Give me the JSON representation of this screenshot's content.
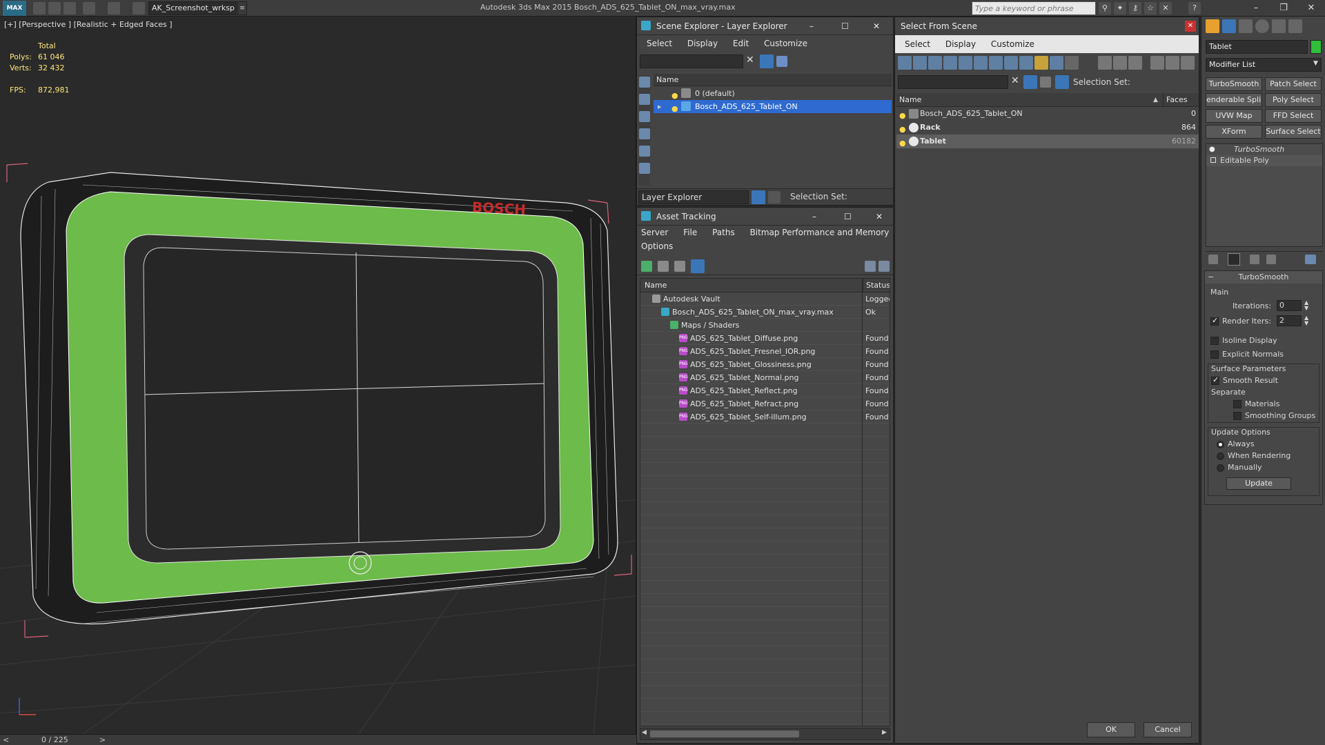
{
  "titlebar": {
    "logo": "MAX",
    "workspace": "AK_Screenshot_wrksp",
    "app_title": "Autodesk 3ds Max  2015     Bosch_ADS_625_Tablet_ON_max_vray.max",
    "search_placeholder": "Type a keyword or phrase"
  },
  "viewport": {
    "label": "[+] [Perspective ] [Realistic + Edged Faces ]",
    "total_label": "Total",
    "polys_label": "Polys:",
    "polys_value": "61 046",
    "verts_label": "Verts:",
    "verts_value": "32 432",
    "fps_label": "FPS:",
    "fps_value": "872,981",
    "brand_text": "BOSCH",
    "timeline": "0 / 225",
    "timeline_prev": "<",
    "timeline_next": ">"
  },
  "scene_explorer": {
    "title": "Scene Explorer - Layer Explorer",
    "menus": [
      "Select",
      "Display",
      "Edit",
      "Customize"
    ],
    "col_name": "Name",
    "layers": [
      {
        "name": "0 (default)",
        "selected": false
      },
      {
        "name": "Bosch_ADS_625_Tablet_ON",
        "selected": true
      }
    ],
    "footer_dropdown": "Layer Explorer",
    "selection_set_label": "Selection Set:"
  },
  "asset_tracking": {
    "title": "Asset Tracking",
    "menus": [
      "Server",
      "File",
      "Paths",
      "Bitmap Performance and Memory"
    ],
    "menu2": "Options",
    "col_name": "Name",
    "col_status": "Status",
    "rows": [
      {
        "name": "Autodesk Vault",
        "status": "Logged",
        "indent": 1,
        "icon": "vault-icon"
      },
      {
        "name": "Bosch_ADS_625_Tablet_ON_max_vray.max",
        "status": "Ok",
        "indent": 2,
        "icon": "max-file-icon"
      },
      {
        "name": "Maps / Shaders",
        "status": "",
        "indent": 3,
        "icon": "maps-icon"
      },
      {
        "name": "ADS_625_Tablet_Diffuse.png",
        "status": "Found",
        "indent": 4,
        "icon": "png-icon"
      },
      {
        "name": "ADS_625_Tablet_Fresnel_IOR.png",
        "status": "Found",
        "indent": 4,
        "icon": "png-icon"
      },
      {
        "name": "ADS_625_Tablet_Glossiness.png",
        "status": "Found",
        "indent": 4,
        "icon": "png-icon"
      },
      {
        "name": "ADS_625_Tablet_Normal.png",
        "status": "Found",
        "indent": 4,
        "icon": "png-icon"
      },
      {
        "name": "ADS_625_Tablet_Reflect.png",
        "status": "Found",
        "indent": 4,
        "icon": "png-icon"
      },
      {
        "name": "ADS_625_Tablet_Refract.png",
        "status": "Found",
        "indent": 4,
        "icon": "png-icon"
      },
      {
        "name": "ADS_625_Tablet_Self-illum.png",
        "status": "Found",
        "indent": 4,
        "icon": "png-icon"
      }
    ],
    "png_badge": "PNG"
  },
  "select_from_scene": {
    "title": "Select From Scene",
    "menus": [
      "Select",
      "Display",
      "Customize"
    ],
    "selection_set_label": "Selection Set:",
    "col_name": "Name",
    "col_faces": "Faces",
    "objects": [
      {
        "name": "Bosch_ADS_625_Tablet_ON",
        "faces": "0",
        "bold": false,
        "selected": false
      },
      {
        "name": "Rack",
        "faces": "864",
        "bold": true,
        "selected": false
      },
      {
        "name": "Tablet",
        "faces": "60182",
        "bold": true,
        "selected": true
      }
    ],
    "ok": "OK",
    "cancel": "Cancel"
  },
  "command_panel": {
    "object_name": "Tablet",
    "object_color": "#2fbf3a",
    "modifier_list": "Modifier List",
    "mod_buttons": [
      "TurboSmooth",
      "Patch Select",
      "enderable Splir",
      "Poly Select",
      "UVW Map",
      "FFD Select",
      "XForm",
      "Surface Select"
    ],
    "stack": [
      "TurboSmooth",
      "Editable Poly"
    ],
    "rollout_title": "TurboSmooth",
    "main_label": "Main",
    "iterations_label": "Iterations:",
    "iterations_value": "0",
    "render_iters_label": "Render Iters:",
    "render_iters_value": "2",
    "isoline": "Isoline Display",
    "explicit_normals": "Explicit Normals",
    "surface_params": "Surface Parameters",
    "smooth_result": "Smooth Result",
    "separate": "Separate",
    "materials": "Materials",
    "smoothing_groups": "Smoothing Groups",
    "update_options": "Update Options",
    "always": "Always",
    "when_rendering": "When Rendering",
    "manually": "Manually",
    "update_button": "Update"
  }
}
